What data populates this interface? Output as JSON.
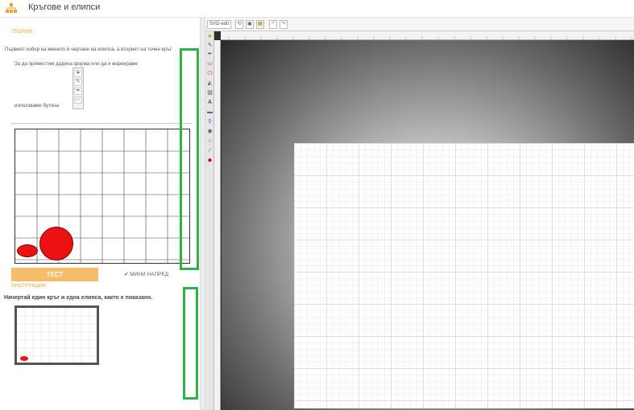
{
  "header": {
    "title": "Кръгове и елипси",
    "logo_icon": "org-chart-icon"
  },
  "left_panel": {
    "theory_label": "ТЕОРИЯ:",
    "theory_line1": "Първият избор на менюто в чертане на елипса, а вторият на точен кръг:",
    "theory_line2": "За да преместим дадена форма или да я маркираме",
    "theory_line3": "използваме бутона",
    "test_button": "ТЕСТ",
    "next_link": "✔ МИНИ НАПРЕД",
    "instructions_label": "ИНСТРУКЦИИ:",
    "instructions_text": "Начертай един кръг и една елипса, както е показано."
  },
  "editor": {
    "logo_label": "SVG-edit",
    "tool_icons": [
      "select-arrow-icon",
      "pencil-icon",
      "pen-icon",
      "rect-icon",
      "ellipse-icon",
      "path-icon",
      "image-icon",
      "text-icon",
      "image-icon",
      "zoom-icon",
      "circle-icon",
      "star-icon",
      "line-icon",
      "shape-icon"
    ]
  },
  "colors": {
    "accent": "#f0a12e",
    "button": "#f5bd6a",
    "shape_fill": "#ee1111",
    "highlight": "#2fb24a"
  }
}
